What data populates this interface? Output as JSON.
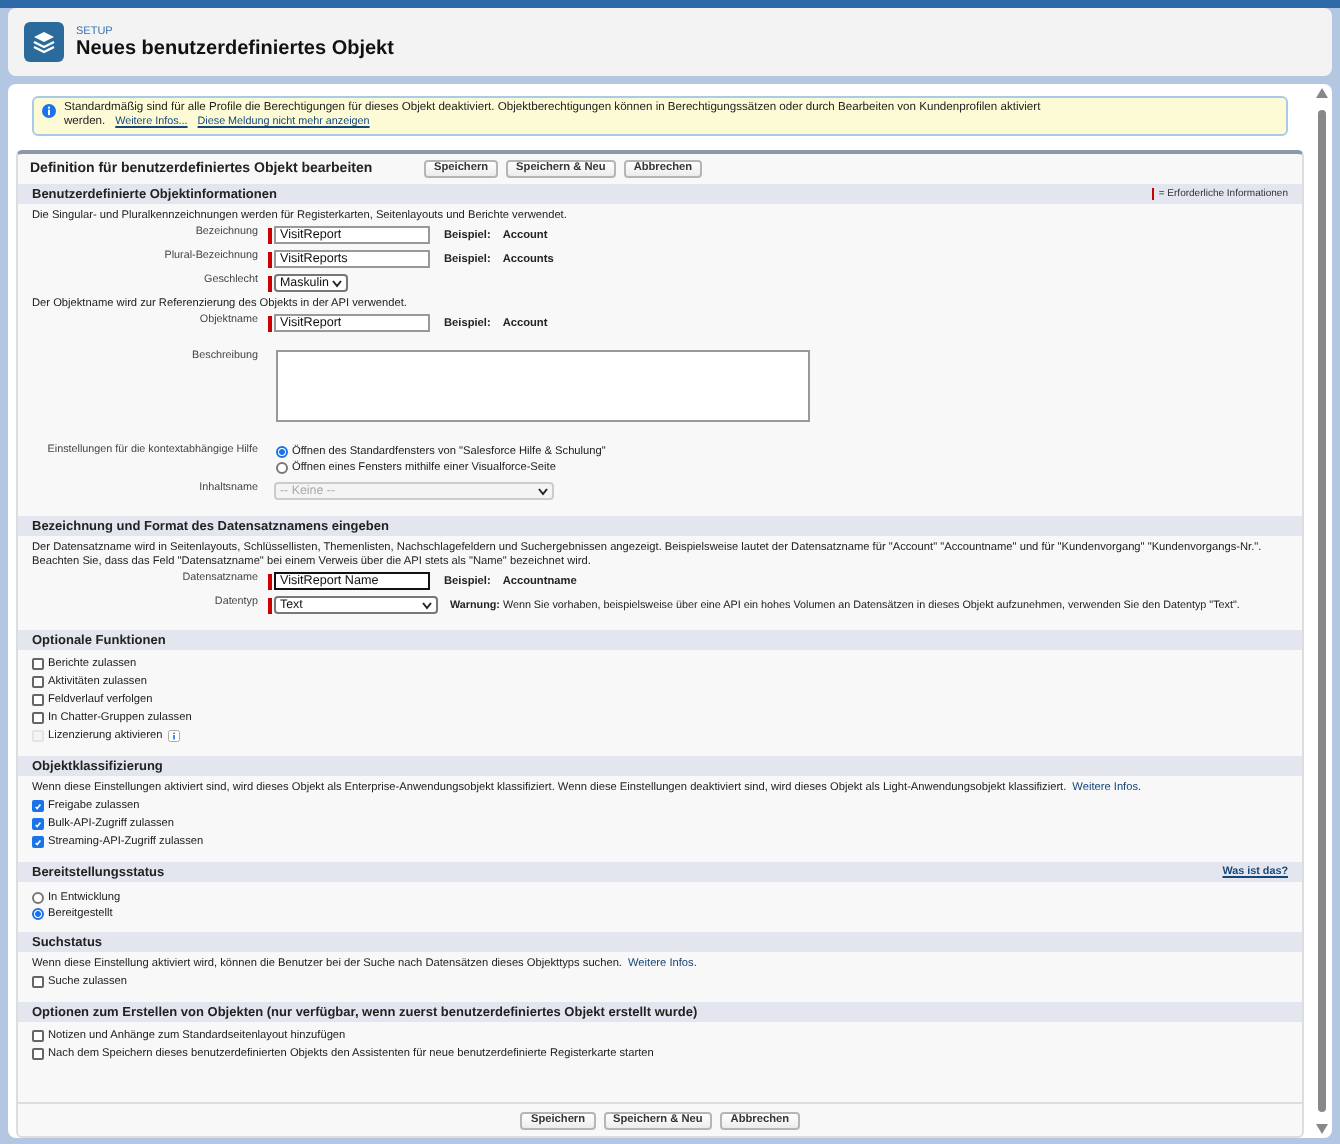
{
  "header": {
    "eyebrow": "SETUP",
    "title": "Neues benutzerdefiniertes Objekt"
  },
  "notice": {
    "text": "Standardmäßig sind für alle Profile die Berechtigungen für dieses Objekt deaktiviert. Objektberechtigungen können in Berechtigungssätzen oder durch Bearbeiten von Kundenprofilen aktiviert werden.",
    "links": [
      "Weitere Infos...",
      "Diese Meldung nicht mehr anzeigen"
    ]
  },
  "form": {
    "title": "Definition für benutzerdefiniertes Objekt bearbeiten",
    "buttons": [
      "Speichern",
      "Speichern & Neu",
      "Abbrechen"
    ],
    "footer_buttons": [
      "Speichern",
      "Speichern & Neu",
      "Abbrechen"
    ]
  },
  "sections": [
    {
      "title": "Benutzerdefinierte Objektinformationen",
      "legend": "= Erforderliche Informationen",
      "items": [
        {
          "kind": "note",
          "text": "Die Singular- und Pluralkennzeichnungen werden für Registerkarten, Seitenlayouts und Berichte verwendet."
        },
        {
          "kind": "input",
          "label": "Bezeichnung",
          "value": "VisitReport",
          "required": true,
          "focused": false,
          "example_label": "Beispiel:",
          "example": "Account"
        },
        {
          "kind": "input",
          "label": "Plural-Bezeichnung",
          "value": "VisitReports",
          "required": true,
          "focused": false,
          "example_label": "Beispiel:",
          "example": "Accounts"
        },
        {
          "kind": "select",
          "label": "Geschlecht",
          "value": "Maskulin",
          "required": true,
          "disabled": false
        },
        {
          "kind": "note",
          "text": "Der Objektname wird zur Referenzierung des Objekts in der API verwendet."
        },
        {
          "kind": "input",
          "label": "Objektname",
          "value": "VisitReport",
          "required": true,
          "focused": false,
          "example_label": "Beispiel:",
          "example": "Account"
        },
        {
          "kind": "textarea",
          "label": "Beschreibung"
        },
        {
          "kind": "radios",
          "label": "Einstellungen für die kontextabhängige Hilfe",
          "options": [
            {
              "label": "Öffnen des Standardfensters von \"Salesforce Hilfe & Schulung\"",
              "selected": true
            },
            {
              "label": "Öffnen eines Fensters mithilfe einer Visualforce-Seite",
              "selected": false
            }
          ]
        },
        {
          "kind": "select",
          "label": "Inhaltsname",
          "value": "-- Keine --",
          "required": false,
          "disabled": true
        }
      ]
    },
    {
      "title": "Bezeichnung und Format des Datensatznamens eingeben",
      "items": [
        {
          "kind": "note",
          "text": "Der Datensatzname wird in Seitenlayouts, Schlüssellisten, Themenlisten, Nachschlagefeldern und Suchergebnissen angezeigt. Beispielsweise lautet der Datensatzname für \"Account\" \"Accountname\" und für \"Kundenvorgang\" \"Kundenvorgangs-Nr.\". Beachten Sie, dass das Feld \"Datensatzname\" bei einem Verweis über die API stets als \"Name\" bezeichnet wird."
        },
        {
          "kind": "input",
          "label": "Datensatzname",
          "value": "VisitReport Name",
          "required": true,
          "focused": true,
          "example_label": "Beispiel:",
          "example": "Accountname"
        },
        {
          "kind": "select",
          "label": "Datentyp",
          "value": "Text",
          "required": true,
          "disabled": false,
          "warning_label": "Warnung:",
          "warning": "Wenn Sie vorhaben, beispielsweise über eine API ein hohes Volumen an Datensätzen in dieses Objekt aufzunehmen, verwenden Sie den Datentyp \"Text\"."
        }
      ]
    },
    {
      "title": "Optionale Funktionen",
      "items": [
        {
          "kind": "checkbox",
          "label": "Berichte zulassen",
          "checked": false,
          "disabled": false
        },
        {
          "kind": "checkbox",
          "label": "Aktivitäten zulassen",
          "checked": false,
          "disabled": false
        },
        {
          "kind": "checkbox",
          "label": "Feldverlauf verfolgen",
          "checked": false,
          "disabled": false
        },
        {
          "kind": "checkbox",
          "label": "In Chatter-Gruppen zulassen",
          "checked": false,
          "disabled": false
        },
        {
          "kind": "checkbox",
          "label": "Lizenzierung aktivieren",
          "checked": false,
          "disabled": true,
          "info": true
        }
      ]
    },
    {
      "title": "Objektklassifizierung",
      "items": [
        {
          "kind": "note",
          "text": "Wenn diese Einstellungen aktiviert sind, wird dieses Objekt als Enterprise-Anwendungsobjekt klassifiziert. Wenn diese Einstellungen deaktiviert sind, wird dieses Objekt als Light-Anwendungsobjekt klassifiziert.",
          "link": "Weitere Infos."
        },
        {
          "kind": "checkbox",
          "label": "Freigabe zulassen",
          "checked": true,
          "disabled": false
        },
        {
          "kind": "checkbox",
          "label": "Bulk-API-Zugriff zulassen",
          "checked": true,
          "disabled": false
        },
        {
          "kind": "checkbox",
          "label": "Streaming-API-Zugriff zulassen",
          "checked": true,
          "disabled": false
        }
      ]
    },
    {
      "title": "Bereitstellungsstatus",
      "help_link": "Was ist das?",
      "items": [
        {
          "kind": "radios",
          "options": [
            {
              "label": "In Entwicklung",
              "selected": false
            },
            {
              "label": "Bereitgestellt",
              "selected": true
            }
          ]
        }
      ]
    },
    {
      "title": "Suchstatus",
      "items": [
        {
          "kind": "note",
          "text": "Wenn diese Einstellung aktiviert wird, können die Benutzer bei der Suche nach Datensätzen dieses Objekttyps suchen.",
          "link": "Weitere Infos."
        },
        {
          "kind": "checkbox",
          "label": "Suche zulassen",
          "checked": false,
          "disabled": false
        }
      ]
    },
    {
      "title": "Optionen zum Erstellen von Objekten (nur verfügbar, wenn zuerst benutzerdefiniertes Objekt erstellt wurde)",
      "items": [
        {
          "kind": "checkbox",
          "label": "Notizen und Anhänge zum Standardseitenlayout hinzufügen",
          "checked": false,
          "disabled": false
        },
        {
          "kind": "checkbox",
          "label": "Nach dem Speichern dieses benutzerdefinierten Objekts den Assistenten für neue benutzerdefinierte Registerkarte starten",
          "checked": false,
          "disabled": false
        }
      ]
    }
  ]
}
